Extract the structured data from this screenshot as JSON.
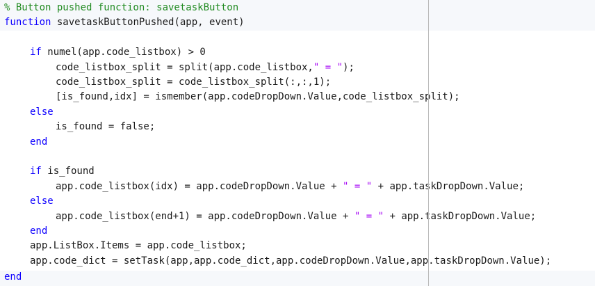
{
  "editor": {
    "colors": {
      "background": "#ffffff",
      "function_band": "#f6f8fb",
      "comment": "#228b22",
      "keyword": "#0e00ff",
      "string": "#a709f5",
      "text": "#1a1a1a",
      "right_margin_line": "#b9b9b9"
    },
    "lines": [
      {
        "tokens": [
          {
            "type": "comment",
            "text": "% Button pushed function: savetaskButton"
          }
        ]
      },
      {
        "tokens": [
          {
            "type": "keyword",
            "text": "function"
          },
          {
            "type": "plain",
            "text": " savetaskButtonPushed(app, event)"
          }
        ]
      },
      {
        "tokens": []
      },
      {
        "tokens": [
          {
            "type": "keyword",
            "text": "if"
          },
          {
            "type": "plain",
            "text": " numel(app.code_listbox) > 0"
          }
        ]
      },
      {
        "tokens": [
          {
            "type": "plain",
            "text": "code_listbox_split = split(app.code_listbox,"
          },
          {
            "type": "string",
            "text": "\" = \""
          },
          {
            "type": "plain",
            "text": ");"
          }
        ]
      },
      {
        "tokens": [
          {
            "type": "plain",
            "text": "code_listbox_split = code_listbox_split(:,:,1);"
          }
        ]
      },
      {
        "tokens": [
          {
            "type": "plain",
            "text": "[is_found,idx] = ismember(app.codeDropDown.Value,code_listbox_split);"
          }
        ]
      },
      {
        "tokens": [
          {
            "type": "keyword",
            "text": "else"
          }
        ]
      },
      {
        "tokens": [
          {
            "type": "plain",
            "text": "is_found = false;"
          }
        ]
      },
      {
        "tokens": [
          {
            "type": "keyword",
            "text": "end"
          }
        ]
      },
      {
        "tokens": []
      },
      {
        "tokens": [
          {
            "type": "keyword",
            "text": "if"
          },
          {
            "type": "plain",
            "text": " is_found"
          }
        ]
      },
      {
        "tokens": [
          {
            "type": "plain",
            "text": "app.code_listbox(idx) = app.codeDropDown.Value + "
          },
          {
            "type": "string",
            "text": "\" = \""
          },
          {
            "type": "plain",
            "text": " + app.taskDropDown.Value;"
          }
        ]
      },
      {
        "tokens": [
          {
            "type": "keyword",
            "text": "else"
          }
        ]
      },
      {
        "tokens": [
          {
            "type": "plain",
            "text": "app.code_listbox(end+1) = app.codeDropDown.Value + "
          },
          {
            "type": "string",
            "text": "\" = \""
          },
          {
            "type": "plain",
            "text": " + app.taskDropDown.Value;"
          }
        ]
      },
      {
        "tokens": [
          {
            "type": "keyword",
            "text": "end"
          }
        ]
      },
      {
        "tokens": [
          {
            "type": "plain",
            "text": "app.ListBox.Items = app.code_listbox;"
          }
        ]
      },
      {
        "tokens": [
          {
            "type": "plain",
            "text": "app.code_dict = setTask(app,app.code_dict,app.codeDropDown.Value,app.taskDropDown.Value);"
          }
        ]
      },
      {
        "tokens": [
          {
            "type": "keyword",
            "text": "end"
          }
        ]
      }
    ]
  }
}
